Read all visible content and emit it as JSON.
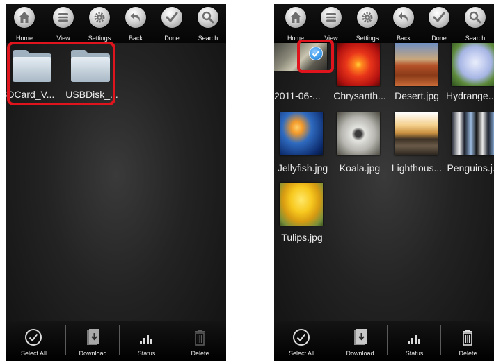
{
  "toolbar": {
    "home_label": "Home",
    "view_label": "View",
    "settings_label": "Settings",
    "back_label": "Back",
    "done_label": "Done",
    "search_label": "Search"
  },
  "left_panel": {
    "folders": [
      {
        "name": "SDCard_V...",
        "icon": "folder-icon"
      },
      {
        "name": "USBDisk_...",
        "icon": "folder-icon"
      }
    ]
  },
  "right_panel": {
    "files": [
      {
        "name": "2011-06-...",
        "thumbnail": "photo-thumbnail",
        "selected": true
      },
      {
        "name": "Chrysanth...",
        "thumbnail": "chrysanthemum-thumbnail"
      },
      {
        "name": "Desert.jpg",
        "thumbnail": "desert-thumbnail"
      },
      {
        "name": "Hydrange...",
        "thumbnail": "hydrangea-thumbnail"
      },
      {
        "name": "Jellyfish.jpg",
        "thumbnail": "jellyfish-thumbnail"
      },
      {
        "name": "Koala.jpg",
        "thumbnail": "koala-thumbnail"
      },
      {
        "name": "Lighthous...",
        "thumbnail": "lighthouse-thumbnail"
      },
      {
        "name": "Penguins.j...",
        "thumbnail": "penguins-thumbnail"
      },
      {
        "name": "Tulips.jpg",
        "thumbnail": "tulips-thumbnail"
      }
    ]
  },
  "bottombar": {
    "select_all_label": "Select All",
    "download_label": "Download",
    "status_label": "Status",
    "delete_label": "Delete"
  },
  "colors": {
    "highlight": "#e0141c",
    "check": "#3d9be9"
  }
}
